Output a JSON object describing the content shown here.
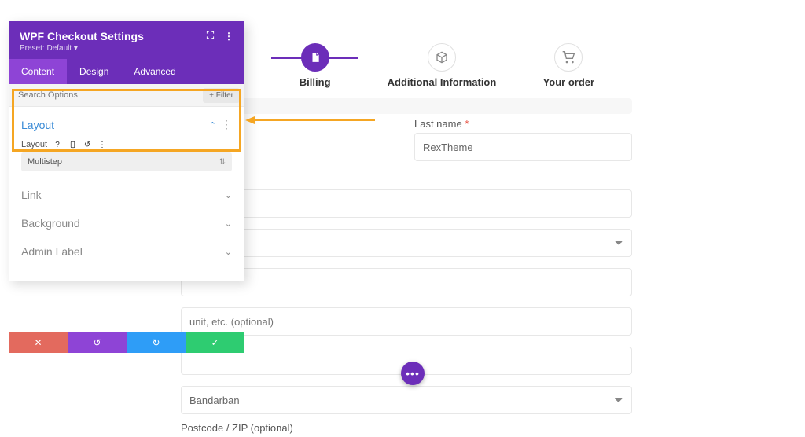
{
  "panel": {
    "title": "WPF Checkout Settings",
    "preset": "Preset: Default",
    "tabs": [
      "Content",
      "Design",
      "Advanced"
    ],
    "search_placeholder": "Search Options",
    "filter_btn": "+ Filter",
    "sections": {
      "layout": {
        "title": "Layout",
        "field_label": "Layout",
        "field_value": "Multistep"
      },
      "link": "Link",
      "background": "Background",
      "admin_label": "Admin Label"
    }
  },
  "steps": {
    "billing": "Billing",
    "additional": "Additional Information",
    "order": "Your order"
  },
  "form": {
    "last_name_label": "Last name",
    "last_name_value": "RexTheme",
    "optional_suffix": "optional)",
    "apt_placeholder": "unit, etc. (optional)",
    "district_value": "Bandarban",
    "postcode_label": "Postcode / ZIP (optional)"
  }
}
